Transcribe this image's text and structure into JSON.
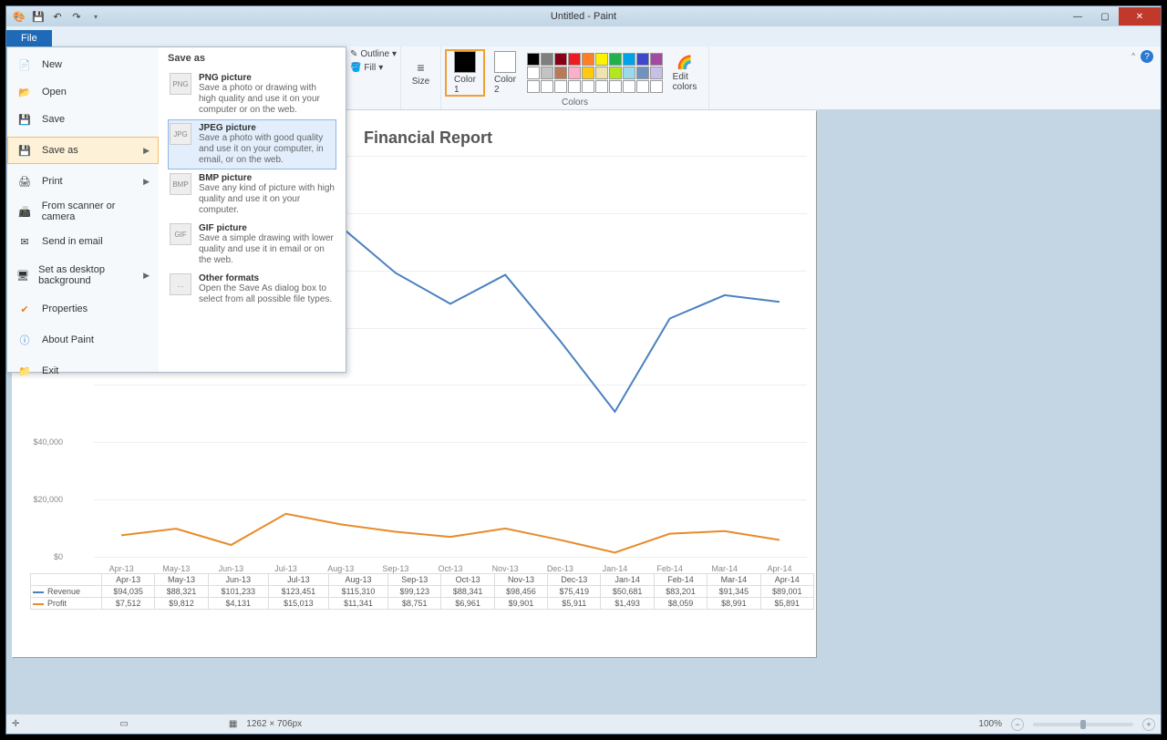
{
  "window": {
    "title": "Untitled - Paint"
  },
  "tabs": {
    "file": "File"
  },
  "ribbon": {
    "outline": "Outline",
    "fill": "Fill",
    "size": "Size",
    "color1": "Color\n1",
    "color2": "Color\n2",
    "editcolors": "Edit\ncolors",
    "colors_label": "Colors"
  },
  "file_menu": {
    "new": "New",
    "open": "Open",
    "save": "Save",
    "save_as": "Save as",
    "print": "Print",
    "scanner": "From scanner or camera",
    "email": "Send in email",
    "desktop": "Set as desktop background",
    "properties": "Properties",
    "about": "About Paint",
    "exit": "Exit",
    "saveas_header": "Save as",
    "png": {
      "t": "PNG picture",
      "d": "Save a photo or drawing with high quality and use it on your computer or on the web."
    },
    "jpeg": {
      "t": "JPEG picture",
      "d": "Save a photo with good quality and use it on your computer, in email, or on the web."
    },
    "bmp": {
      "t": "BMP picture",
      "d": "Save any kind of picture with high quality and use it on your computer."
    },
    "gif": {
      "t": "GIF picture",
      "d": "Save a simple drawing with lower quality and use it in email or on the web."
    },
    "other": {
      "t": "Other formats",
      "d": "Open the Save As dialog box to select from all possible file types."
    }
  },
  "chart_data": {
    "type": "line",
    "title": "Financial Report",
    "categories": [
      "Apr-13",
      "May-13",
      "Jun-13",
      "Jul-13",
      "Aug-13",
      "Sep-13",
      "Oct-13",
      "Nov-13",
      "Dec-13",
      "Jan-14",
      "Feb-14",
      "Mar-14",
      "Apr-14"
    ],
    "series": [
      {
        "name": "Revenue",
        "color": "#4a80c0",
        "values": [
          94035,
          88321,
          101233,
          123451,
          115310,
          99123,
          88341,
          98456,
          75419,
          50681,
          83201,
          91345,
          89001
        ],
        "display": [
          "$94,035",
          "$88,321",
          "$101,233",
          "$123,451",
          "$115,310",
          "$99,123",
          "$88,341",
          "$98,456",
          "$75,419",
          "$50,681",
          "$83,201",
          "$91,345",
          "$89,001"
        ]
      },
      {
        "name": "Profit",
        "color": "#e78b2a",
        "values": [
          7512,
          9812,
          4131,
          15013,
          11341,
          8751,
          6961,
          9901,
          5911,
          1493,
          8059,
          8991,
          5891
        ],
        "display": [
          "$7,512",
          "$9,812",
          "$4,131",
          "$15,013",
          "$11,341",
          "$8,751",
          "$6,961",
          "$9,901",
          "$5,911",
          "$1,493",
          "$8,059",
          "$8,991",
          "$5,891"
        ]
      }
    ],
    "ylim": [
      0,
      140000
    ],
    "yticks": [
      0,
      20000,
      40000
    ],
    "ytick_labels": [
      "$0",
      "$20,000",
      "$40,000"
    ]
  },
  "status": {
    "dims": "1262 × 706px",
    "zoom": "100%"
  },
  "palette": [
    "#000",
    "#7f7f7f",
    "#880015",
    "#ed1c24",
    "#ff7f27",
    "#fff200",
    "#22b14c",
    "#00a2e8",
    "#3f48cc",
    "#a349a4",
    "#fff",
    "#c3c3c3",
    "#b97a57",
    "#ffaec9",
    "#ffc90e",
    "#efe4b0",
    "#b5e61d",
    "#99d9ea",
    "#7092be",
    "#c8bfe7",
    "#fff",
    "#fff",
    "#fff",
    "#fff",
    "#fff",
    "#fff",
    "#fff",
    "#fff",
    "#fff",
    "#fff"
  ]
}
